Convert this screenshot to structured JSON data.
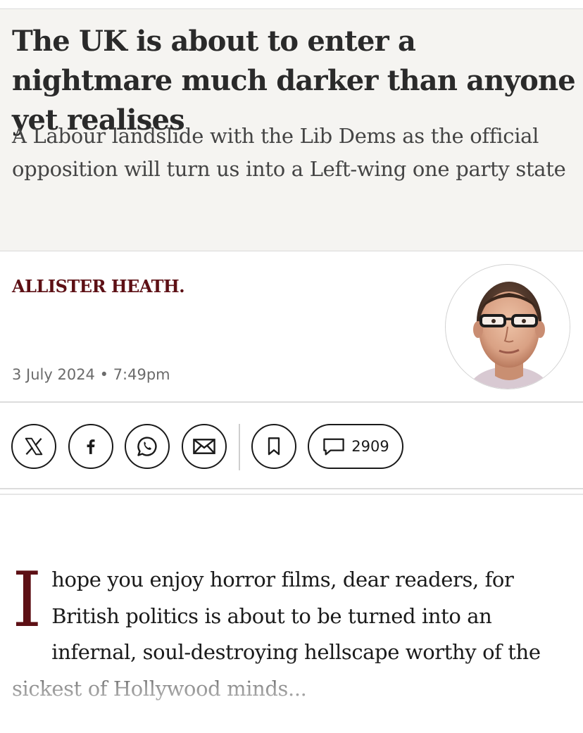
{
  "article": {
    "headline": "The UK is about to enter a nightmare much darker than anyone yet realises",
    "standfirst": "A Labour landslide with the Lib Dems as the official opposition will turn us into a Left-wing one party state",
    "author": "ALLISTER HEATH",
    "author_suffix": ".",
    "date": "3 July 2024",
    "separator": "•",
    "time": "7:49pm",
    "dropcap": "I",
    "body_preview": "hope you enjoy horror films, dear readers, for British politics is about to be turned into an infernal, soul-destroying hellscape worthy of the sickest of Hollywood minds..."
  },
  "share": {
    "buttons": [
      {
        "icon": "x-logo-icon"
      },
      {
        "icon": "facebook-icon"
      },
      {
        "icon": "whatsapp-icon"
      },
      {
        "icon": "email-icon"
      },
      {
        "icon": "bookmark-icon"
      }
    ],
    "comments_icon": "comment-bubble-icon",
    "comments_count": "2909"
  },
  "colors": {
    "byline": "#5d1015",
    "dropcap": "#5d1015",
    "header_background": "#f5f4f1",
    "text": "#1a1a1a",
    "meta": "#6b6b6b"
  }
}
